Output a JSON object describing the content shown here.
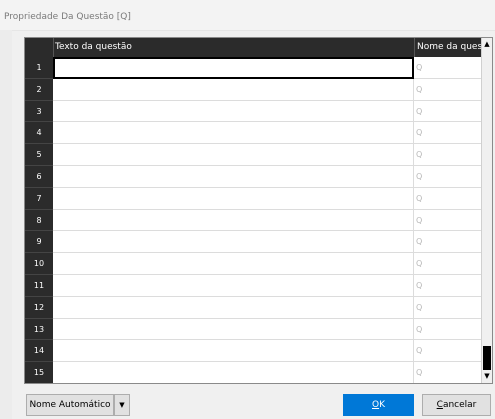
{
  "window": {
    "title": "Propriedade Da Questão [Q]"
  },
  "grid": {
    "columns": [
      "Texto da questão",
      "Nome da questão"
    ],
    "rows": [
      {
        "num": "1",
        "text": "",
        "name": "Q"
      },
      {
        "num": "2",
        "text": "",
        "name": "Q"
      },
      {
        "num": "3",
        "text": "",
        "name": "Q"
      },
      {
        "num": "4",
        "text": "",
        "name": "Q"
      },
      {
        "num": "5",
        "text": "",
        "name": "Q"
      },
      {
        "num": "6",
        "text": "",
        "name": "Q"
      },
      {
        "num": "7",
        "text": "",
        "name": "Q"
      },
      {
        "num": "8",
        "text": "",
        "name": "Q"
      },
      {
        "num": "9",
        "text": "",
        "name": "Q"
      },
      {
        "num": "10",
        "text": "",
        "name": "Q"
      },
      {
        "num": "11",
        "text": "",
        "name": "Q"
      },
      {
        "num": "12",
        "text": "",
        "name": "Q"
      },
      {
        "num": "13",
        "text": "",
        "name": "Q"
      },
      {
        "num": "14",
        "text": "",
        "name": "Q"
      },
      {
        "num": "15",
        "text": "",
        "name": "Q"
      }
    ],
    "active_row": 1
  },
  "buttons": {
    "auto_name": "Nome Automático",
    "ok_first": "O",
    "ok_rest": "K",
    "cancel_first": "C",
    "cancel_rest": "ancelar"
  },
  "colors": {
    "accent": "#0078d7",
    "header_bg": "#2b2b2b"
  }
}
